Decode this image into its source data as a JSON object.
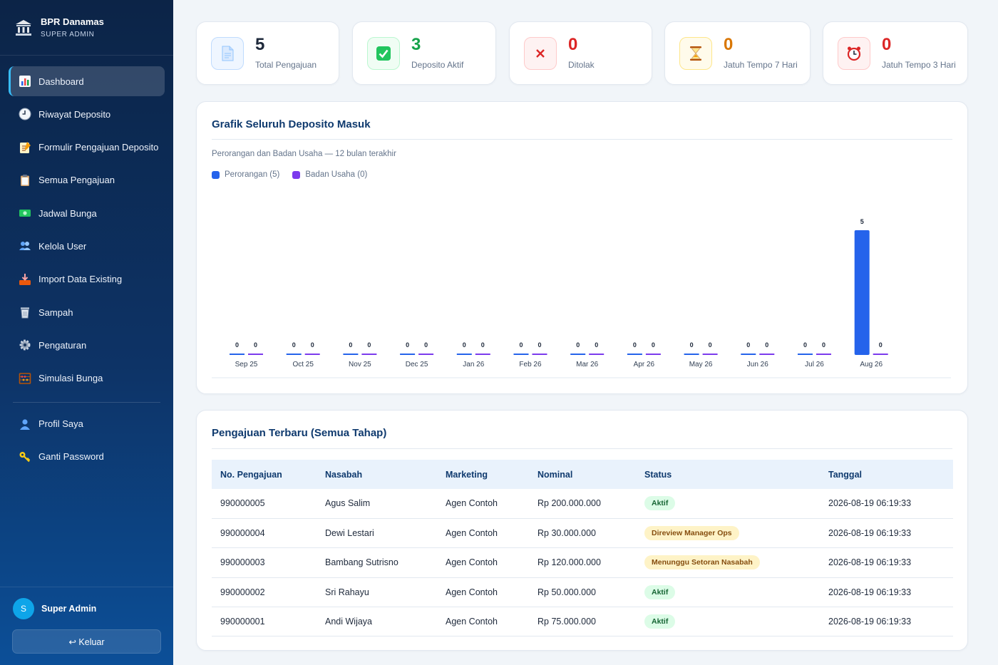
{
  "app": {
    "brand_name": "BPR Danamas",
    "brand_role": "SUPER ADMIN"
  },
  "sidebar": {
    "items": [
      {
        "label": "Dashboard",
        "icon": "chart-icon",
        "active": true
      },
      {
        "label": "Riwayat Deposito",
        "icon": "clock-icon"
      },
      {
        "label": "Formulir Pengajuan Deposito",
        "icon": "memo-icon"
      },
      {
        "label": "Semua Pengajuan",
        "icon": "clipboard-icon"
      },
      {
        "label": "Jadwal Bunga",
        "icon": "money-icon"
      },
      {
        "label": "Kelola User",
        "icon": "users-icon"
      },
      {
        "label": "Import Data Existing",
        "icon": "inbox-tray-icon"
      },
      {
        "label": "Sampah",
        "icon": "trash-icon"
      },
      {
        "label": "Pengaturan",
        "icon": "gear-icon"
      },
      {
        "label": "Simulasi Bunga",
        "icon": "abacus-icon"
      }
    ],
    "secondary": [
      {
        "label": "Profil Saya",
        "icon": "user-icon"
      },
      {
        "label": "Ganti Password",
        "icon": "key-icon"
      }
    ],
    "user": {
      "initial": "S",
      "name": "Super Admin"
    },
    "logout_label": "↩ Keluar"
  },
  "stats": [
    {
      "value": "5",
      "label": "Total Pengajuan",
      "color": "#1e293b"
    },
    {
      "value": "3",
      "label": "Deposito Aktif",
      "color": "#16a34a"
    },
    {
      "value": "0",
      "label": "Ditolak",
      "color": "#dc2626"
    },
    {
      "value": "0",
      "label": "Jatuh Tempo 7 Hari",
      "color": "#d97706"
    },
    {
      "value": "0",
      "label": "Jatuh Tempo 3 Hari",
      "color": "#dc2626"
    }
  ],
  "chart": {
    "title": "Grafik Seluruh Deposito Masuk",
    "subtitle": "Perorangan dan Badan Usaha — 12 bulan terakhir",
    "legend": [
      {
        "label": "Perorangan (5)",
        "color": "#2563eb"
      },
      {
        "label": "Badan Usaha (0)",
        "color": "#7c3aed"
      }
    ]
  },
  "chart_data": {
    "type": "bar",
    "title": "Grafik Seluruh Deposito Masuk",
    "subtitle": "Perorangan dan Badan Usaha — 12 bulan terakhir",
    "categories": [
      "Sep 25",
      "Oct 25",
      "Nov 25",
      "Dec 25",
      "Jan 26",
      "Feb 26",
      "Mar 26",
      "Apr 26",
      "May 26",
      "Jun 26",
      "Jul 26",
      "Aug 26"
    ],
    "series": [
      {
        "name": "Perorangan (5)",
        "color": "#2563eb",
        "values": [
          0,
          0,
          0,
          0,
          0,
          0,
          0,
          0,
          0,
          0,
          0,
          5
        ]
      },
      {
        "name": "Badan Usaha (0)",
        "color": "#7c3aed",
        "values": [
          0,
          0,
          0,
          0,
          0,
          0,
          0,
          0,
          0,
          0,
          0,
          0
        ]
      }
    ],
    "ylim": [
      0,
      5
    ],
    "grid": false,
    "legend_position": "top-left",
    "data_labels": true
  },
  "table": {
    "title": "Pengajuan Terbaru (Semua Tahap)",
    "columns": [
      "No. Pengajuan",
      "Nasabah",
      "Marketing",
      "Nominal",
      "Status",
      "Tanggal"
    ],
    "rows": [
      {
        "no": "990000005",
        "nasabah": "Agus Salim",
        "marketing": "Agen Contoh",
        "nominal": "Rp 200.000.000",
        "status": "Aktif",
        "status_type": "aktif",
        "tanggal": "2026-08-19 06:19:33"
      },
      {
        "no": "990000004",
        "nasabah": "Dewi Lestari",
        "marketing": "Agen Contoh",
        "nominal": "Rp 30.000.000",
        "status": "Direview Manager Ops",
        "status_type": "warn",
        "tanggal": "2026-08-19 06:19:33"
      },
      {
        "no": "990000003",
        "nasabah": "Bambang Sutrisno",
        "marketing": "Agen Contoh",
        "nominal": "Rp 120.000.000",
        "status": "Menunggu Setoran Nasabah",
        "status_type": "warn",
        "tanggal": "2026-08-19 06:19:33"
      },
      {
        "no": "990000002",
        "nasabah": "Sri Rahayu",
        "marketing": "Agen Contoh",
        "nominal": "Rp 50.000.000",
        "status": "Aktif",
        "status_type": "aktif",
        "tanggal": "2026-08-19 06:19:33"
      },
      {
        "no": "990000001",
        "nasabah": "Andi Wijaya",
        "marketing": "Agen Contoh",
        "nominal": "Rp 75.000.000",
        "status": "Aktif",
        "status_type": "aktif",
        "tanggal": "2026-08-19 06:19:33"
      }
    ]
  }
}
